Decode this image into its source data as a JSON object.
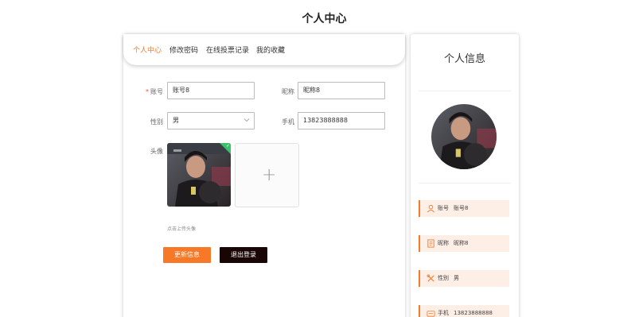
{
  "page": {
    "title": "个人中心"
  },
  "tabs": [
    {
      "label": "个人中心",
      "active": true
    },
    {
      "label": "修改密码",
      "active": false
    },
    {
      "label": "在线投票记录",
      "active": false
    },
    {
      "label": "我的收藏",
      "active": false
    }
  ],
  "form": {
    "account": {
      "label": "账号",
      "value": "账号8"
    },
    "nickname": {
      "label": "昵称",
      "value": "昵称8"
    },
    "gender": {
      "label": "性别",
      "value": "男"
    },
    "phone": {
      "label": "手机",
      "value": "13823888888"
    },
    "avatar": {
      "label": "头像",
      "hint": "点击上传头像"
    }
  },
  "buttons": {
    "update": "更新信息",
    "logout": "退出登录"
  },
  "profile": {
    "title": "个人信息",
    "rows": [
      {
        "label": "账号",
        "value": "账号8",
        "icon": "user-icon"
      },
      {
        "label": "昵称",
        "value": "昵称8",
        "icon": "document-icon"
      },
      {
        "label": "性别",
        "value": "男",
        "icon": "tools-icon"
      },
      {
        "label": "手机",
        "value": "13823888888",
        "icon": "phone-icon"
      }
    ]
  },
  "colors": {
    "accent": "#f47b2a",
    "update_button": "#f77826",
    "logout_button": "#1a0505",
    "info_row_bg": "#fdeee6",
    "success": "#3bc16a"
  }
}
